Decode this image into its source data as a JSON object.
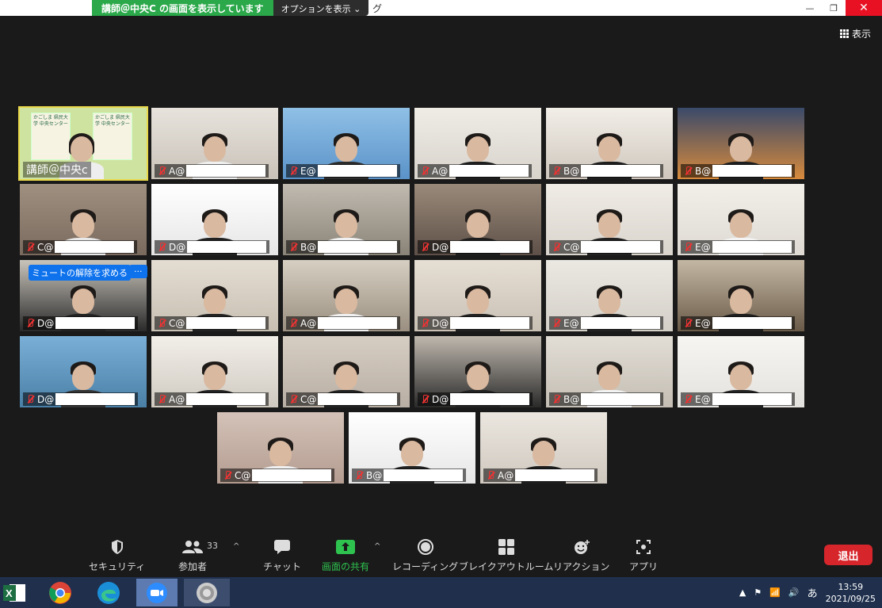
{
  "window": {
    "title_fragment": "グ",
    "share_banner": "講師＠中央C の画面を表示しています",
    "options_button": "オプションを表示 ⌄",
    "minimize": "—",
    "restore": "❐",
    "close": "✕"
  },
  "view_button": "表示",
  "host_tile": {
    "name": "講師＠中央c",
    "sign_left": "かごしま 県民大学 中央センター",
    "sign_right": "かごしま 県民大学 中央センター"
  },
  "participants": [
    {
      "name": "A@",
      "bg": "#c9c2b9",
      "wall": "#e7e3dc",
      "shirt": "#f0f0f0"
    },
    {
      "name": "E@",
      "bg": "#5b93c9",
      "wall": "#8fc0e6",
      "shirt": "#2b2b2b"
    },
    {
      "name": "A@",
      "bg": "#d8d4cc",
      "wall": "#efece6",
      "shirt": "#1e1e1e"
    },
    {
      "name": "B@",
      "bg": "#cfc7bd",
      "wall": "#f2eee8",
      "shirt": "#1e1e1e"
    },
    {
      "name": "B@",
      "bg": "#d88a3c",
      "wall": "#3a4a6a",
      "shirt": "#1e1e1e"
    },
    {
      "name": "C@",
      "bg": "#7a6a5e",
      "wall": "#a09080",
      "shirt": "#e8e8e8"
    },
    {
      "name": "D@",
      "bg": "#e6e6e6",
      "wall": "#ffffff",
      "shirt": "#222"
    },
    {
      "name": "B@",
      "bg": "#8a8478",
      "wall": "#c0bab0",
      "shirt": "#f0f0f0"
    },
    {
      "name": "D@",
      "bg": "#5e5048",
      "wall": "#9a8a7a",
      "shirt": "#1e1e1e"
    },
    {
      "name": "C@",
      "bg": "#d9d4cc",
      "wall": "#f0ece6",
      "shirt": "#222"
    },
    {
      "name": "E@",
      "bg": "#dedad3",
      "wall": "#f2efe9",
      "shirt": "#f4f4f4"
    },
    {
      "name": "D@",
      "bg": "#2a2a2a",
      "wall": "#c9c4bb",
      "shirt": "#222"
    },
    {
      "name": "C@",
      "bg": "#c8bfb2",
      "wall": "#e4ddd2",
      "shirt": "#222"
    },
    {
      "name": "A@",
      "bg": "#9a8f80",
      "wall": "#d6cfc2",
      "shirt": "#f0f0f0"
    },
    {
      "name": "D@",
      "bg": "#c9c0b4",
      "wall": "#e6dfd4",
      "shirt": "#222"
    },
    {
      "name": "E@",
      "bg": "#d4d0c8",
      "wall": "#ebe8e2",
      "shirt": "#222"
    },
    {
      "name": "E@",
      "bg": "#6a5a48",
      "wall": "#c4b8a4",
      "shirt": "#1e1e1e"
    },
    {
      "name": "D@",
      "bg": "#4a7fa6",
      "wall": "#7ab0d8",
      "shirt": "#333"
    },
    {
      "name": "A@",
      "bg": "#cfc9c0",
      "wall": "#f2efe9",
      "shirt": "#222"
    },
    {
      "name": "C@",
      "bg": "#b8aea4",
      "wall": "#d6cdc3",
      "shirt": "#222"
    },
    {
      "name": "D@",
      "bg": "#2a2a2a",
      "wall": "#bfb8ae",
      "shirt": "#222"
    },
    {
      "name": "B@",
      "bg": "#c4beb4",
      "wall": "#e2ddd5",
      "shirt": "#f4f4f4"
    },
    {
      "name": "E@",
      "bg": "#e4e2de",
      "wall": "#f6f5f2",
      "shirt": "#222"
    },
    {
      "name": "C@",
      "bg": "#b49c90",
      "wall": "#d4c2b8",
      "shirt": "#f0f0f0"
    },
    {
      "name": "B@",
      "bg": "#e6e6e6",
      "wall": "#ffffff",
      "shirt": "#222"
    },
    {
      "name": "A@",
      "bg": "#cfc8bf",
      "wall": "#ebe6df",
      "shirt": "#1e1e1e"
    }
  ],
  "unmute_request": "ミュートの解除を求める",
  "more_button": "···",
  "toolbar": {
    "security": "セキュリティ",
    "participants": "参加者",
    "participants_count": "33",
    "chat": "チャット",
    "share": "画面の共有",
    "record": "レコーディング",
    "breakout": "ブレイクアウトルーム",
    "reactions": "リアクション",
    "apps": "アプリ",
    "leave": "退出"
  },
  "taskbar": {
    "ime": "あ",
    "time": "13:59",
    "date": "2021/09/25"
  },
  "colors": {
    "share_green": "#2aa84a",
    "leave_red": "#d6262c",
    "zoom_blue": "#0e72ed",
    "active_speaker": "#e8d84a"
  }
}
